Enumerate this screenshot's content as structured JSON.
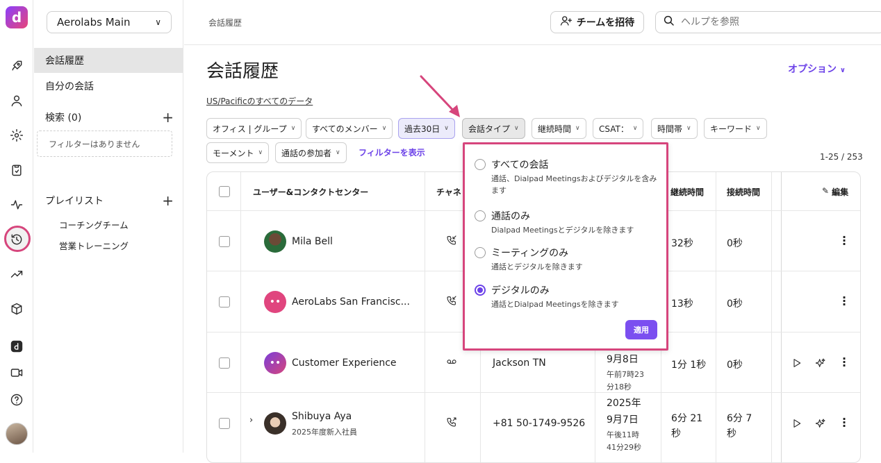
{
  "app": {
    "logo_letter": "d"
  },
  "workspace": {
    "name": "Aerolabs Main"
  },
  "sidebar": {
    "items": [
      {
        "label": "会話履歴"
      },
      {
        "label": "自分の会話"
      }
    ],
    "search_label": "検索 (0)",
    "no_filter": "フィルターはありません",
    "playlist_label": "プレイリスト",
    "playlists": [
      {
        "label": "コーチングチーム"
      },
      {
        "label": "営業トレーニング"
      }
    ]
  },
  "header": {
    "breadcrumb": "会話履歴",
    "invite_label": "チームを招待",
    "search_placeholder": "ヘルプを参照"
  },
  "page": {
    "title": "会話履歴",
    "options_label": "オプション",
    "timezone_note": "US/Pacificのすべてのデータ",
    "show_filters": "フィルターを表示",
    "count": "1-25 / 253"
  },
  "filters": {
    "office": "オフィス | グループ",
    "members": "すべてのメンバー",
    "period": "過去30日",
    "type": "会話タイプ",
    "duration": "継続時間",
    "csat": "CSAT：",
    "timeslot": "時間帯",
    "keyword": "キーワード",
    "moment": "モーメント",
    "participants": "通話の参加者"
  },
  "table": {
    "headers": {
      "user": "ユーザー&コンタクトセンター",
      "channel": "チャネ",
      "duration": "継続時間",
      "connect": "接続時間",
      "edit": "編集"
    },
    "rows": [
      {
        "name": "Mila Bell",
        "sub": "",
        "contact": "",
        "date1": "",
        "date2": "",
        "time1": "",
        "time2": "",
        "duration": "32秒",
        "connect": "0秒"
      },
      {
        "name": "AeroLabs San Francisc...",
        "sub": "",
        "contact": "",
        "date1": "",
        "date2": "",
        "time1": "",
        "time2": "",
        "duration": "13秒",
        "connect": "0秒"
      },
      {
        "name": "Customer Experience",
        "sub": "",
        "contact": "Jackson TN",
        "date1": "9月8日",
        "date2": "",
        "time1": "午前7時23",
        "time2": "分18秒",
        "duration": "1分 1秒",
        "connect": "0秒"
      },
      {
        "name": "Shibuya Aya",
        "sub": "2025年度新入社員",
        "contact": "+81 50-1749-9526",
        "date1": "2025年",
        "date2": "9月7日",
        "time1": "午後11時",
        "time2": "41分29秒",
        "duration_a": "6分 21",
        "duration_b": "秒",
        "connect_a": "6分 7",
        "connect_b": "秒"
      }
    ]
  },
  "popover": {
    "options": [
      {
        "title": "すべての会話",
        "desc": "通話、Dialpad Meetingsおよびデジタルを含みます",
        "selected": false
      },
      {
        "title": "通話のみ",
        "desc": "Dialpad Meetingsとデジタルを除きます",
        "selected": false
      },
      {
        "title": "ミーティングのみ",
        "desc": "通話とデジタルを除きます",
        "selected": false
      },
      {
        "title": "デジタルのみ",
        "desc": "通話とDialpad Meetingsを除きます",
        "selected": true
      }
    ],
    "apply_label": "適用"
  },
  "colors": {
    "accent": "#6c42e8",
    "highlight": "#d6457c"
  }
}
